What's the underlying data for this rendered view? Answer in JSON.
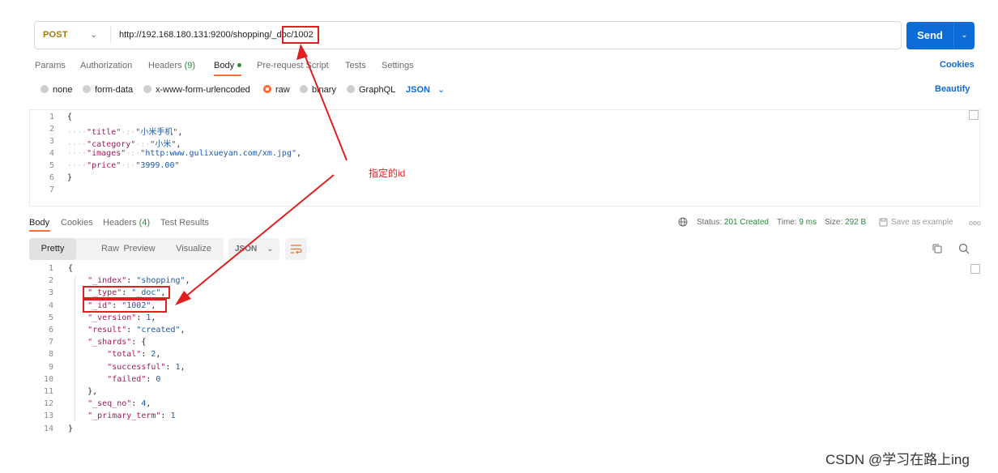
{
  "request": {
    "method": "POST",
    "url": "http://192.168.180.131:9200/shopping/_doc/1002",
    "send_label": "Send"
  },
  "request_tabs": [
    {
      "label": "Params"
    },
    {
      "label": "Authorization"
    },
    {
      "label": "Headers",
      "count": "(9)"
    },
    {
      "label": "Body"
    },
    {
      "label": "Pre-request Script"
    },
    {
      "label": "Tests"
    },
    {
      "label": "Settings"
    }
  ],
  "cookies_label": "Cookies",
  "body_types": [
    "none",
    "form-data",
    "x-www-form-urlencoded",
    "raw",
    "binary",
    "GraphQL"
  ],
  "body_language": "JSON",
  "beautify_label": "Beautify",
  "request_body": {
    "line_numbers": [
      "1",
      "2",
      "3",
      "4",
      "5",
      "6",
      "7"
    ],
    "lines": [
      {
        "indent": "",
        "key": "",
        "sep": "",
        "value": "",
        "tail": "{"
      },
      {
        "indent": "····",
        "key": "\"title\"",
        "sep": "·:·",
        "value": "\"小米手机\"",
        "tail": ","
      },
      {
        "indent": "····",
        "key": "\"category\"",
        "sep": "·:·",
        "value": "\"小米\"",
        "tail": ","
      },
      {
        "indent": "····",
        "key": "\"images\"",
        "sep": "·:·",
        "value": "\"http:www.gulixueyan.com/xm.jpg\"",
        "tail": ","
      },
      {
        "indent": "····",
        "key": "\"price\"",
        "sep": "·:·",
        "value": "\"3999.00\"",
        "tail": ""
      },
      {
        "indent": "",
        "key": "",
        "sep": "",
        "value": "",
        "tail": "}"
      },
      {
        "indent": "",
        "key": "",
        "sep": "",
        "value": "",
        "tail": ""
      }
    ]
  },
  "response_tabs": [
    {
      "label": "Body"
    },
    {
      "label": "Cookies"
    },
    {
      "label": "Headers",
      "count": "(4)"
    },
    {
      "label": "Test Results"
    }
  ],
  "response_meta": {
    "status_label": "Status:",
    "status_value": "201 Created",
    "time_label": "Time:",
    "time_value": "9 ms",
    "size_label": "Size:",
    "size_value": "292 B",
    "save_label": "Save as example",
    "more_label": "ooo"
  },
  "view_tabs": [
    "Pretty",
    "Raw",
    "Preview",
    "Visualize"
  ],
  "response_format": "JSON",
  "response_body": {
    "line_numbers": [
      "1",
      "2",
      "3",
      "4",
      "5",
      "6",
      "7",
      "8",
      "9",
      "10",
      "11",
      "12",
      "13",
      "14"
    ],
    "lines": [
      {
        "indent": "",
        "key": "",
        "value": "",
        "vtype": "",
        "tail": "{"
      },
      {
        "indent": "    ",
        "key": "\"_index\"",
        "value": "\"shopping\"",
        "vtype": "s",
        "tail": ","
      },
      {
        "indent": "    ",
        "key": "\"_type\"",
        "value": "\"_doc\"",
        "vtype": "s",
        "tail": ","
      },
      {
        "indent": "    ",
        "key": "\"_id\"",
        "value": "\"1002\"",
        "vtype": "s",
        "tail": ","
      },
      {
        "indent": "    ",
        "key": "\"_version\"",
        "value": "1",
        "vtype": "n",
        "tail": ","
      },
      {
        "indent": "    ",
        "key": "\"result\"",
        "value": "\"created\"",
        "vtype": "s",
        "tail": ","
      },
      {
        "indent": "    ",
        "key": "\"_shards\"",
        "value": "",
        "vtype": "",
        "tail": ": {"
      },
      {
        "indent": "        ",
        "key": "\"total\"",
        "value": "2",
        "vtype": "n",
        "tail": ","
      },
      {
        "indent": "        ",
        "key": "\"successful\"",
        "value": "1",
        "vtype": "n",
        "tail": ","
      },
      {
        "indent": "        ",
        "key": "\"failed\"",
        "value": "0",
        "vtype": "n",
        "tail": ""
      },
      {
        "indent": "    ",
        "key": "",
        "value": "",
        "vtype": "",
        "tail": "},"
      },
      {
        "indent": "    ",
        "key": "\"_seq_no\"",
        "value": "4",
        "vtype": "n",
        "tail": ","
      },
      {
        "indent": "    ",
        "key": "\"_primary_term\"",
        "value": "1",
        "vtype": "n",
        "tail": ""
      },
      {
        "indent": "",
        "key": "",
        "value": "",
        "vtype": "",
        "tail": "}"
      }
    ]
  },
  "annotation_text": "指定的id",
  "watermark": "CSDN @学习在路上ing",
  "colors": {
    "accent": "#0d6bd8",
    "tab_indicator": "#ff6c37",
    "annotation": "#e02020",
    "status_ok": "#2b8a3e"
  },
  "icons": [
    "chevron-down-icon",
    "globe-icon",
    "save-icon",
    "copy-icon",
    "search-icon",
    "wrap-icon"
  ]
}
